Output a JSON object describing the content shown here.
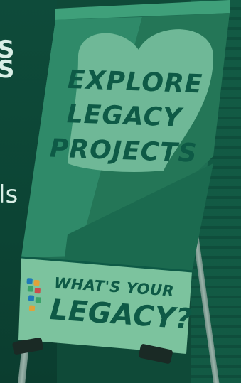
{
  "edge_text": {
    "line1": "S",
    "line2": "S",
    "line3": "ls"
  },
  "banner": {
    "headline": [
      "EXPLORE",
      "LEGACY",
      "PROJECTS"
    ],
    "footer_line1": "WHAT'S YOUR",
    "footer_line2": "LEGACY?"
  },
  "colors": {
    "tint": "#0f4a38",
    "banner_light": "#6fb897",
    "banner_mid": "#2f8a69",
    "banner_dark": "#1f6e53",
    "footer_bg": "#7cc39e",
    "text_dark": "#0e5a46"
  },
  "icons": [
    "easel-foot-left",
    "easel-foot-right",
    "legacy-logo"
  ]
}
